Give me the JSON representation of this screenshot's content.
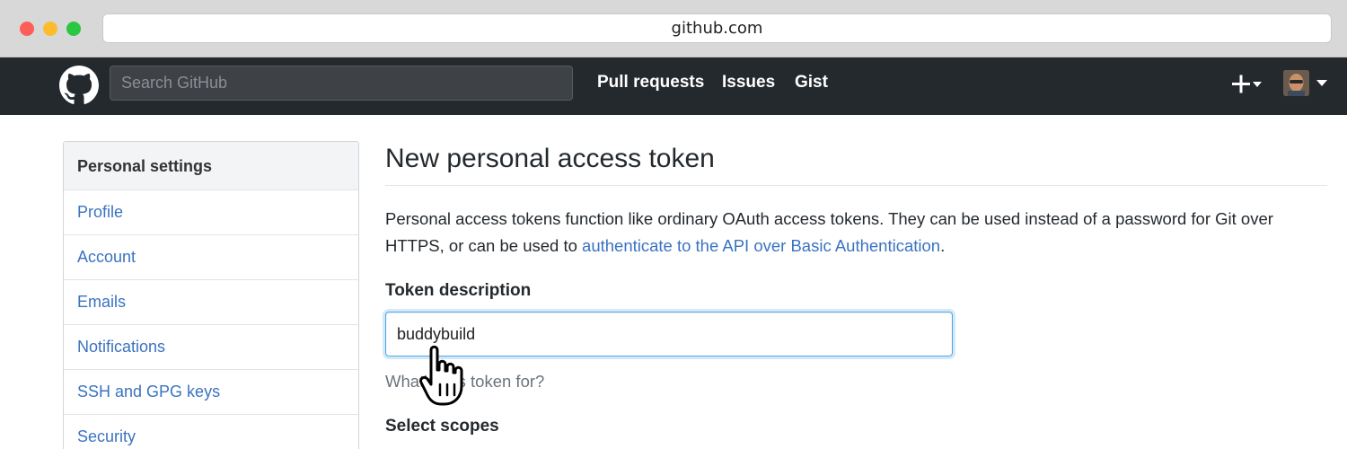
{
  "browser": {
    "url": "github.com"
  },
  "header": {
    "search_placeholder": "Search GitHub",
    "nav": {
      "pull_requests": "Pull requests",
      "issues": "Issues",
      "gist": "Gist"
    }
  },
  "sidebar": {
    "heading": "Personal settings",
    "items": [
      {
        "label": "Profile"
      },
      {
        "label": "Account"
      },
      {
        "label": "Emails"
      },
      {
        "label": "Notifications"
      },
      {
        "label": "SSH and GPG keys"
      },
      {
        "label": "Security"
      }
    ]
  },
  "main": {
    "title": "New personal access token",
    "intro_text": "Personal access tokens function like ordinary OAuth access tokens. They can be used instead of a password for Git over HTTPS, or can be used to ",
    "intro_link": "authenticate to the API over Basic Authentication",
    "intro_end": ".",
    "token_label": "Token description",
    "token_value": "buddybuild",
    "token_help": "What's this token for?",
    "scopes_label": "Select scopes"
  },
  "colors": {
    "header_bg": "#24292e",
    "link": "#3a73c0",
    "focus": "#51a7e8"
  },
  "icons": [
    "github-logo-icon",
    "plus-icon",
    "caret-down-icon",
    "avatar",
    "hand-cursor-icon"
  ]
}
